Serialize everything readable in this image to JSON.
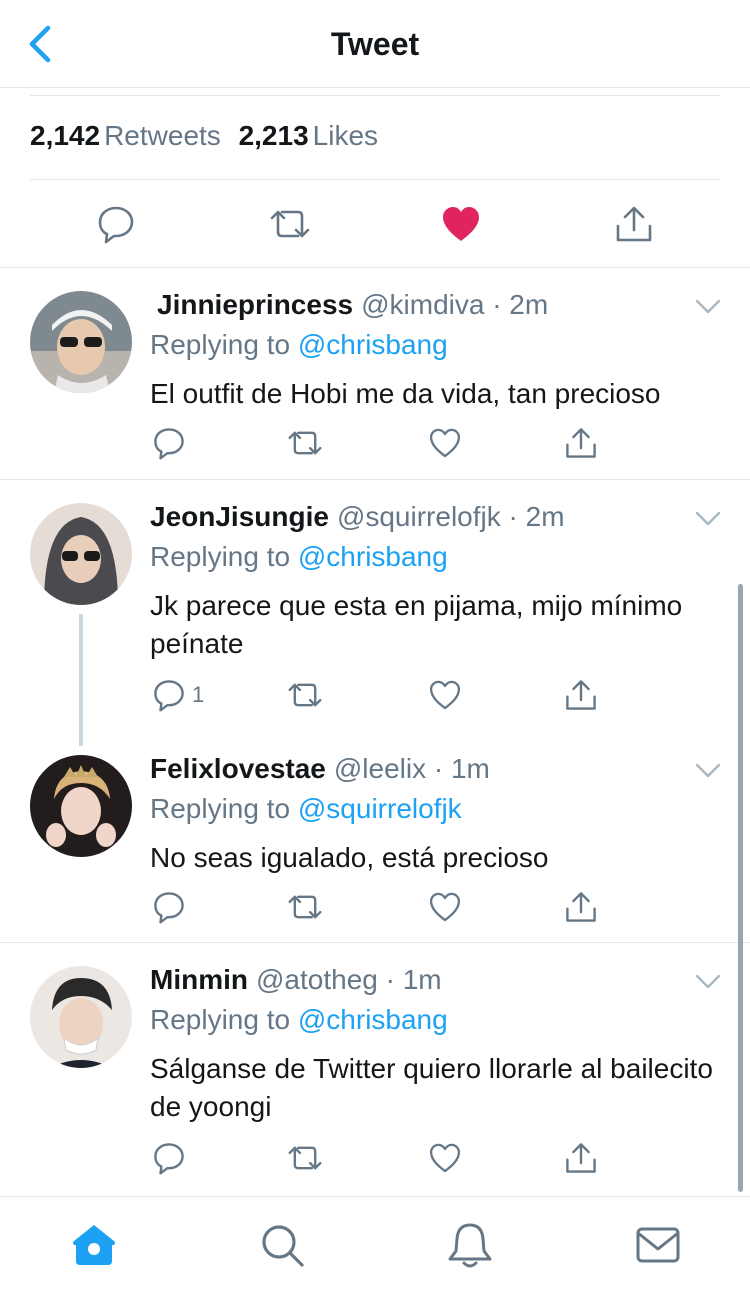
{
  "header": {
    "title": "Tweet"
  },
  "stats": {
    "retweets_count": "2,142",
    "retweets_label": "Retweets",
    "likes_count": "2,213",
    "likes_label": "Likes"
  },
  "colors": {
    "accent": "#1da1f2",
    "like": "#e0245e",
    "muted": "#657786",
    "divider": "#e1e8ed"
  },
  "replies": [
    {
      "name": "Jinnieprincess",
      "handle": "@kimdiva · 2m",
      "replying_label": "Replying to",
      "mention": "@chrisbang",
      "text": "El outfit de Hobi me da vida, tan precioso",
      "reply_count": ""
    },
    {
      "name": "JeonJisungie",
      "handle": "@squirrelofjk · 2m",
      "replying_label": "Replying to",
      "mention": "@chrisbang",
      "text": "Jk parece que esta en pijama, mijo mínimo peínate",
      "reply_count": "1"
    },
    {
      "name": "Felixlovestae",
      "handle": "@leelix · 1m",
      "replying_label": "Replying to",
      "mention": "@squirrelofjk",
      "text": "No seas igualado, está precioso",
      "reply_count": ""
    },
    {
      "name": "Minmin",
      "handle": "@atotheg · 1m",
      "replying_label": "Replying to",
      "mention": "@chrisbang",
      "text": "Sálganse de Twitter quiero llorarle al bailecito de yoongi",
      "reply_count": ""
    }
  ],
  "tabbar": {
    "items": [
      "home-icon",
      "search-icon",
      "notifications-icon",
      "messages-icon"
    ],
    "active": "home-icon"
  }
}
